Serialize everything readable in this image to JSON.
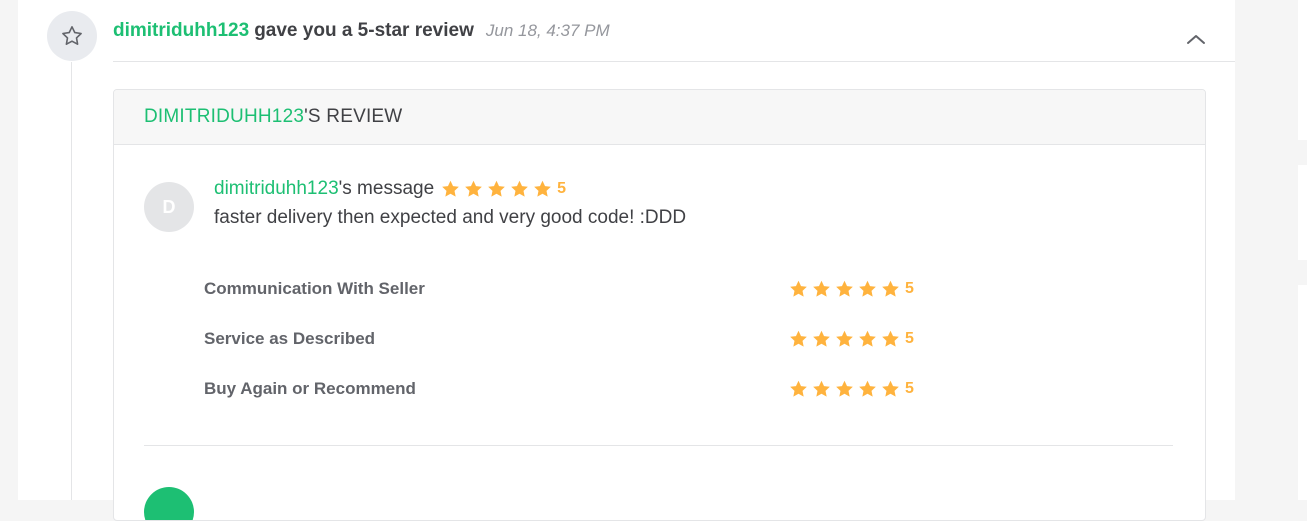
{
  "event": {
    "icon": "star-outline-icon",
    "username": "dimitriduhh123",
    "action_text": "gave you a 5-star review",
    "timestamp": "Jun 18, 4:37 PM",
    "collapse_icon": "chevron-up-icon"
  },
  "review_card": {
    "title_name": "DIMITRIDUHH123",
    "title_suffix": "'S REVIEW",
    "avatar_initial": "D",
    "message_name": "dimitriduhh123",
    "message_suffix": "'s message",
    "overall_rating": 5,
    "overall_rating_label": "5",
    "review_text": "faster delivery then expected and very good code! :DDD",
    "breakdown": [
      {
        "label": "Communication With Seller",
        "rating": 5,
        "rating_label": "5"
      },
      {
        "label": "Service as Described",
        "rating": 5,
        "rating_label": "5"
      },
      {
        "label": "Buy Again or Recommend",
        "rating": 5,
        "rating_label": "5"
      }
    ]
  },
  "colors": {
    "brand_green": "#1dbf73",
    "star_orange": "#ffb33e",
    "text_dark": "#404145",
    "text_muted": "#95979d"
  }
}
